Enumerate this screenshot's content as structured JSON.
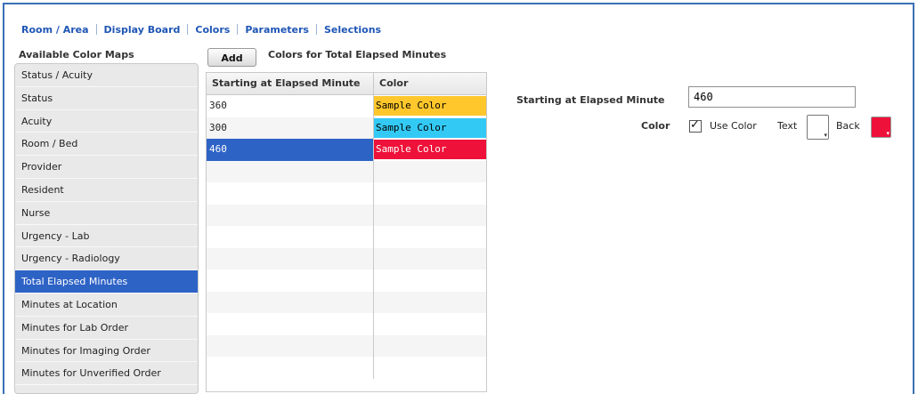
{
  "nav": {
    "items": [
      "Room / Area",
      "Display Board",
      "Colors",
      "Parameters",
      "Selections"
    ]
  },
  "left": {
    "title": "Available Color Maps",
    "items": [
      "Status / Acuity",
      "Status",
      "Acuity",
      "Room / Bed",
      "Provider",
      "Resident",
      "Nurse",
      "Urgency - Lab",
      "Urgency - Radiology",
      "Total Elapsed Minutes",
      "Minutes at Location",
      "Minutes for Lab Order",
      "Minutes for Imaging Order",
      "Minutes for Unverified Order"
    ],
    "selected_index": 9
  },
  "toolbar": {
    "add_label": "Add",
    "table_title": "Colors for Total Elapsed Minutes"
  },
  "table": {
    "headers": [
      "Starting at Elapsed Minute",
      "Color"
    ],
    "rows": [
      {
        "minute": "360",
        "color_label": "Sample Color",
        "bg": "#ffc72c",
        "fg": "#000000"
      },
      {
        "minute": "300",
        "color_label": "Sample Color",
        "bg": "#33c9f5",
        "fg": "#000000"
      },
      {
        "minute": "460",
        "color_label": "Sample Color",
        "bg": "#ee1139",
        "fg": "#ffffff"
      }
    ],
    "selected_index": 2,
    "empty_rows": 10
  },
  "form": {
    "start_label": "Starting at Elapsed Minute",
    "start_value": "460",
    "color_label": "Color",
    "use_color_label": "Use Color",
    "use_color_checked": true,
    "text_label": "Text",
    "back_label": "Back",
    "text_color": "#ffffff",
    "back_color": "#ee1139"
  },
  "colors": {
    "accent": "#2e63c6",
    "link": "#1f56b5",
    "frame": "#3b6fb6"
  },
  "icons": {
    "checkbox_mark": "check-icon",
    "swatch_dropdown": "dropdown-corner-icon"
  }
}
